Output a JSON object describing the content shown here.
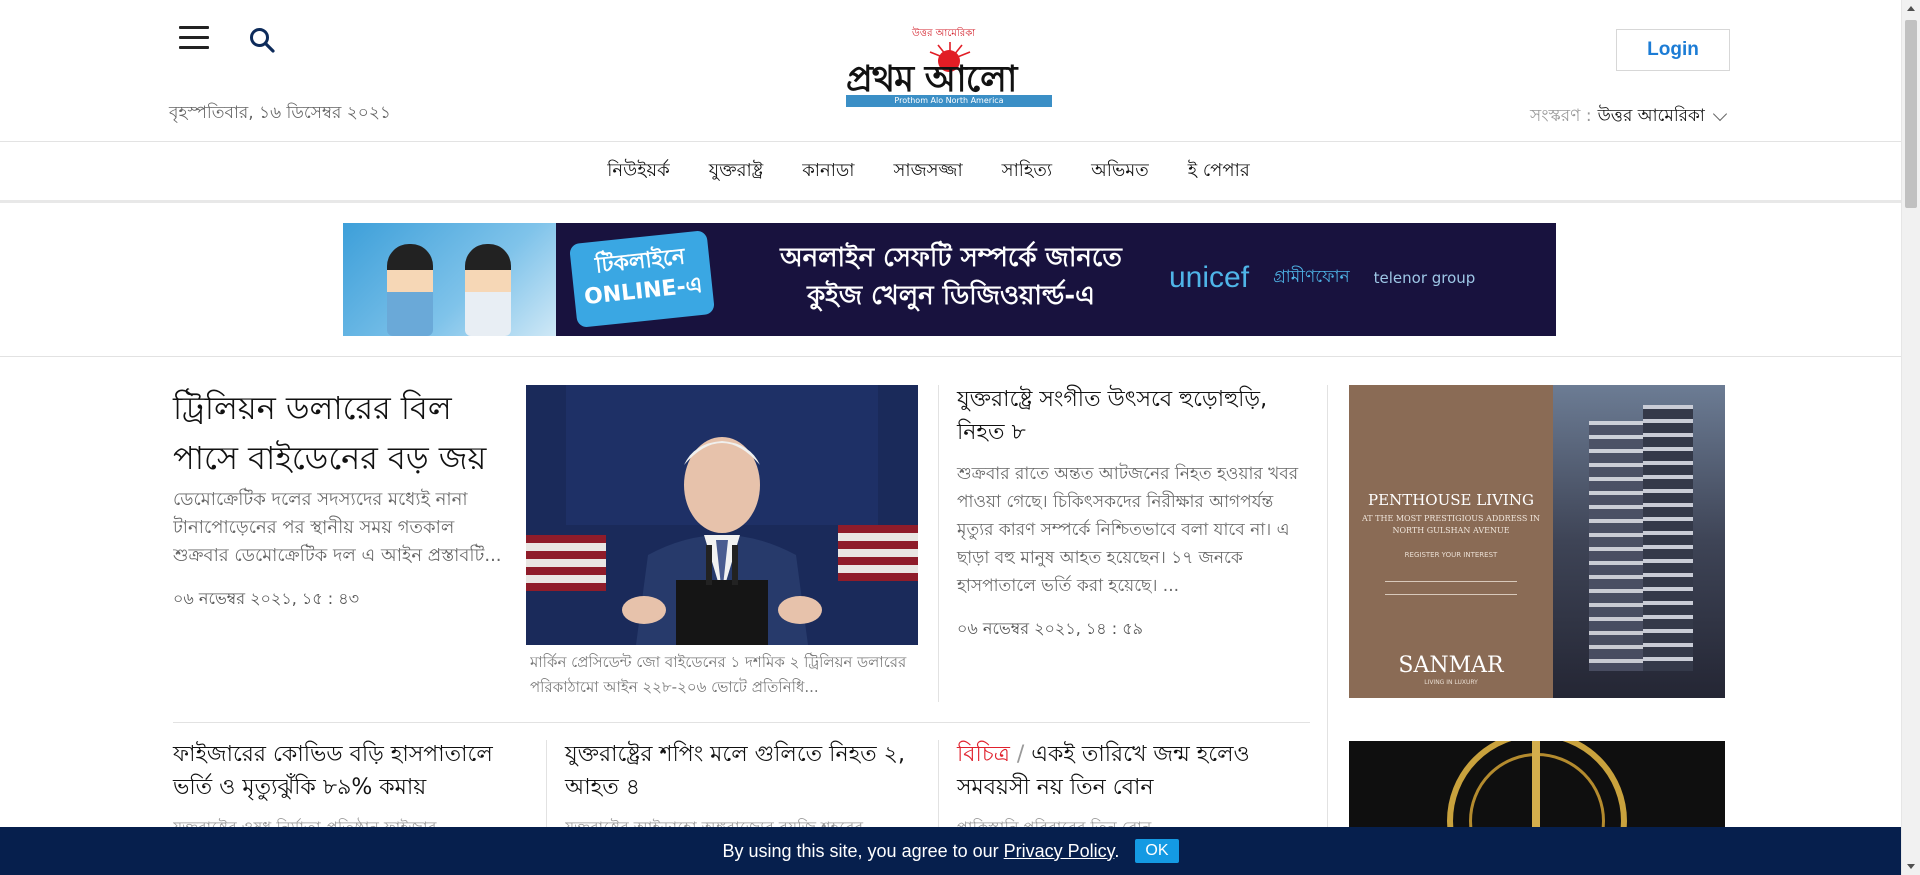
{
  "header": {
    "date": "বৃহস্পতিবার, ১৬ ডিসেম্বর ২০২১",
    "logo_text": "প্রথম আলো",
    "logo_tagline": "উত্তর আমেরিকা",
    "logo_strip": "Prothom Alo North America",
    "login_label": "Login",
    "edition_label": "সংস্করণ :",
    "edition_value": "উত্তর আমেরিকা"
  },
  "nav": {
    "items": [
      "নিউইয়র্ক",
      "যুক্তরাষ্ট্র",
      "কানাডা",
      "সাজসজ্জা",
      "সাহিত্য",
      "অভিমত",
      "ই পেপার"
    ]
  },
  "banner": {
    "badge": "টিকলাইনে ONLINE-এ",
    "headline_1": "অনলাইন সেফটি সম্পর্কে জানতে",
    "headline_2": "কুইজ খেলুন ডিজিওয়ার্ল্ড-এ",
    "sponsor_1": "unicef",
    "sponsor_2": "গ্রামীণফোন",
    "sponsor_3": "telenor group"
  },
  "lead": {
    "title": "ট্রিলিয়ন ডলারের বিল পাসে বাইডেনের বড় জয়",
    "summary": "ডেমোক্রেটিক দলের সদস্যদের মধ্যেই নানা টানাপোড়েনের পর স্থানীয় সময় গতকাল শুক্রবার ডেমোক্রেটিক দল এ আইন প্রস্তাবটি...",
    "time": "০৬ নভেম্বর ২০২১, ১৫ : ৪৩",
    "caption": "মার্কিন প্রেসিডেন্ট জো বাইডেনের ১ দশমিক ২ ট্রিলিয়ন ডলারের পরিকাঠামো আইন ২২৮-২০৬ ভোটে প্রতিনিধি..."
  },
  "story2": {
    "title": "যুক্তরাষ্ট্রে সংগীত উৎসবে হুড়োহুড়ি, নিহত ৮",
    "summary": "শুক্রবার রাতে অন্তত আটজনের নিহত হওয়ার খবর পাওয়া গেছে। চিকিৎসকদের নিরীক্ষার আগপর্যন্ত মৃত্যুর কারণ সম্পর্কে নিশ্চিতভাবে বলা যাবে না। এ ছাড়া বহু মানুষ আহত হয়েছেন। ১৭ জনকে হাসপাতালে ভর্তি করা হয়েছে। ...",
    "time": "০৬ নভেম্বর ২০২১, ১৪ : ৫৯"
  },
  "row2": [
    {
      "title": "ফাইজারের কোভিড বড়ি হাসপাতালে ভর্তি ও মৃত্যুঝুঁকি ৮৯% কমায়",
      "kicker": "",
      "sub": "যুক্তরাষ্ট্রের ওষুধ নির্মাতা প্রতিষ্ঠান ফাইজার"
    },
    {
      "title": "যুক্তরাষ্ট্রের শপিং মলে গুলিতে নিহত ২, আহত ৪",
      "kicker": "",
      "sub": "যুক্তরাষ্ট্রের আইডাহো অঙ্গরাজ্যের বয়জি শহরের"
    },
    {
      "title": "একই তারিখে জন্ম হলেও সমবয়সী নয় তিন বোন",
      "kicker": "বিচিত্র",
      "sub": "পাকিস্তানি পরিবারের তিন বোন"
    }
  ],
  "ads": {
    "ad1_title": "PENTHOUSE LIVING",
    "ad1_sub": "AT THE MOST PRESTIGIOUS ADDRESS IN NORTH GULSHAN AVENUE",
    "ad1_register": "REGISTER YOUR INTEREST",
    "ad1_brand": "SANMAR",
    "ad1_brand_sub": "LIVING IN LUXURY"
  },
  "cookie": {
    "text": "By using this site, you agree to our",
    "link": "Privacy Policy",
    "period": ".",
    "ok": "OK"
  },
  "colors": {
    "accent": "#1c7cd5",
    "kicker": "#e0212d",
    "cookie_bg": "#061f4d",
    "ok_bg": "#149ae3"
  },
  "icons": [
    "hamburger-icon",
    "search-icon",
    "chevron-down-icon"
  ]
}
